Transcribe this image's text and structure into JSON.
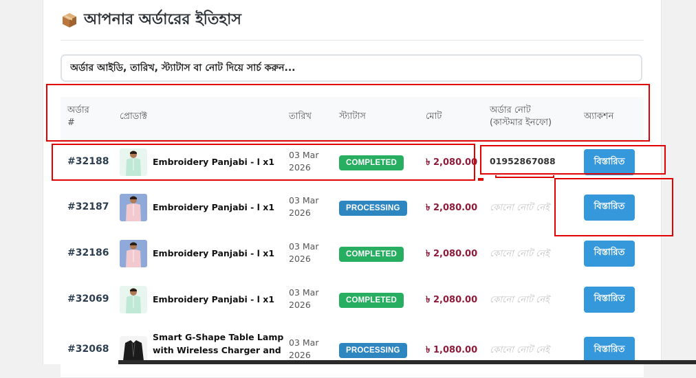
{
  "page": {
    "title": "আপনার অর্ডারের ইতিহাস",
    "title_icon": "package-box-icon",
    "search_placeholder": "অর্ডার আইডি, তারিখ, স্ট্যাটাস বা নোট দিয়ে সার্চ করুন..."
  },
  "table": {
    "headers": {
      "order_line1": "অর্ডার",
      "order_line2": "#",
      "product": "প্রোডাক্ট",
      "date": "তারিখ",
      "status": "স্ট্যাটাস",
      "total": "মোট",
      "note_line1": "অর্ডার নোট",
      "note_line2": "(কাস্টমার ইনফো)",
      "action": "অ্যাকশন"
    },
    "rows": [
      {
        "id": "#32188",
        "product_line1": "Embroidery Panjabi - l x1",
        "product_line2": "",
        "date_line1": "03 Mar",
        "date_line2": "2026",
        "status": "COMPLETED",
        "status_kind": "completed",
        "total": "৳ 2,080.00",
        "note": "01952867088",
        "note_empty": false,
        "action": "বিস্তারিত",
        "thumb": "mint-panjabi"
      },
      {
        "id": "#32187",
        "product_line1": "Embroidery Panjabi - l x1",
        "product_line2": "",
        "date_line1": "03 Mar",
        "date_line2": "2026",
        "status": "PROCESSING",
        "status_kind": "processing",
        "total": "৳ 2,080.00",
        "note": "কোনো নোট নেই",
        "note_empty": true,
        "action": "বিস্তারিত",
        "thumb": "pink-panjabi"
      },
      {
        "id": "#32186",
        "product_line1": "Embroidery Panjabi - l x1",
        "product_line2": "",
        "date_line1": "03 Mar",
        "date_line2": "2026",
        "status": "COMPLETED",
        "status_kind": "completed",
        "total": "৳ 2,080.00",
        "note": "কোনো নোট নেই",
        "note_empty": true,
        "action": "বিস্তারিত",
        "thumb": "pink-panjabi"
      },
      {
        "id": "#32069",
        "product_line1": "Embroidery Panjabi - l x1",
        "product_line2": "",
        "date_line1": "03 Mar",
        "date_line2": "2026",
        "status": "COMPLETED",
        "status_kind": "completed",
        "total": "৳ 2,080.00",
        "note": "কোনো নোট নেই",
        "note_empty": true,
        "action": "বিস্তারিত",
        "thumb": "mint-panjabi"
      },
      {
        "id": "#32068",
        "product_line1": "Smart G-Shape Table Lamp",
        "product_line2": "with Wireless Charger and",
        "date_line1": "03 Mar",
        "date_line2": "2026",
        "status": "PROCESSING",
        "status_kind": "processing",
        "total": "৳ 1,080.00",
        "note": "কোনো নোট নেই",
        "note_empty": true,
        "action": "বিস্তারিত",
        "thumb": "black-jacket"
      }
    ]
  },
  "colors": {
    "completed": "#27ae60",
    "processing": "#2e86c1",
    "button": "#3498db",
    "total": "#8e1b3a",
    "annotation": "#e00000"
  }
}
